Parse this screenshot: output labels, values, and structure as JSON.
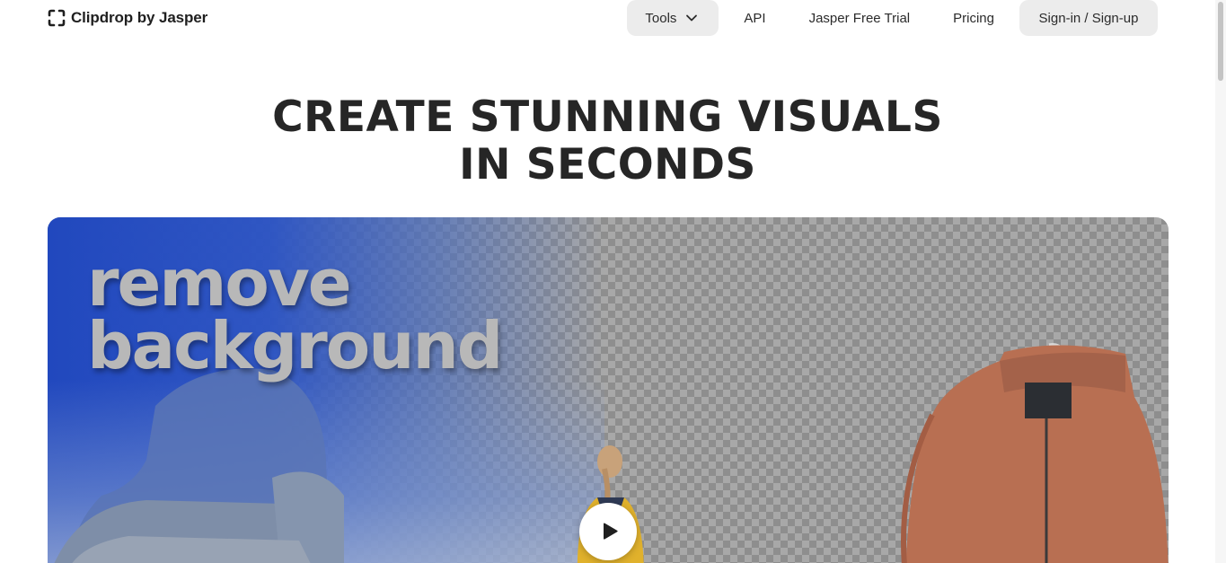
{
  "header": {
    "logo_text": "Clipdrop by Jasper",
    "nav": {
      "tools_label": "Tools",
      "api_label": "API",
      "trial_label": "Jasper Free Trial",
      "pricing_label": "Pricing",
      "signin_label": "Sign-in / Sign-up"
    }
  },
  "hero": {
    "title_line1": "CREATE STUNNING VISUALS",
    "title_line2": "IN SECONDS"
  },
  "video": {
    "overlay_line1": "remove",
    "overlay_line2": "background"
  },
  "colors": {
    "nav_pill_bg": "#ececec",
    "title_text": "#262626",
    "video_blue": "#2148be",
    "jacket": "#b86f52",
    "person_jacket": "#e0b12c"
  },
  "icons": {
    "logo": "clipdrop-logo-icon",
    "tools_chevron": "chevron-down-icon",
    "play": "play-icon"
  }
}
